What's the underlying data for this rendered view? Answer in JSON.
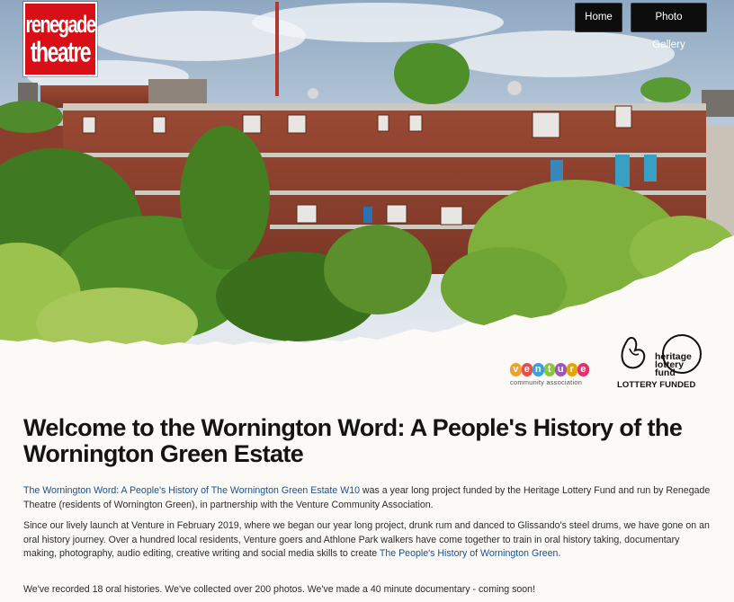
{
  "logo": {
    "line1": "renegade",
    "line2": "theatre"
  },
  "nav": {
    "home_label": "Home",
    "gallery_label": "Photo Gallery"
  },
  "sponsors": {
    "venture_letters": [
      "v",
      "e",
      "n",
      "t",
      "u",
      "r",
      "e"
    ],
    "venture_sub": "community association",
    "lottery_name": "heritage lottery fund",
    "lottery_funded": "LOTTERY FUNDED"
  },
  "main": {
    "title": "Welcome to the Wornington Word: A People's History of the Wornington Green Estate",
    "p1_link": "The Wornington Word: A People's History of The Wornington Green Estate W10",
    "p1_text": " was a year long project funded by the Heritage Lottery Fund and run by Renegade Theatre (residents of Wornington Green), in partnership with the Venture Community Association.",
    "p2_text": "Since our lively launch at Venture in February 2019, where we began our year long project, drunk rum and danced to Glissando's steel drums, we have gone on an oral history journey. Over a hundred local residents, Venture goers and Athlone Park walkers have come together to train in oral history taking, documentary making, photography, audio editing, creative writing and social media skills to create ",
    "p2_link": "The People's History of Wornington Green",
    "p2_end": ".",
    "p3_text": "We've recorded 18 oral histories. We've collected over 200 photos. We've made a 40 minute documentary - coming soon!"
  },
  "colors": {
    "brand_red": "#d80f16",
    "link_blue": "#1b4f8c",
    "nav_bg": "#0d0d0d",
    "venture_colors": [
      "#f0a030",
      "#e84e4e",
      "#3aa0d8",
      "#8cc63e",
      "#9b59b6",
      "#e6a400",
      "#e5306a"
    ]
  }
}
